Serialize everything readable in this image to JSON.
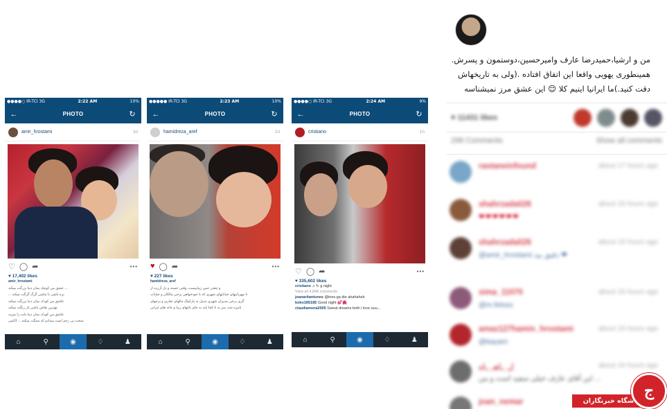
{
  "phones": [
    {
      "status": {
        "carrier": "●●●●○ IR-TCI  3G",
        "time": "2:22 AM",
        "battery": "10%"
      },
      "nav_title": "PHOTO",
      "username": "amir_hrostami",
      "ago": "3d",
      "likes": "♥ 17,402 likes",
      "caption_user": "amir_hrostami",
      "caption_lines": [
        "... عشق من کوچک بمان دنیا بزرگت میکند",
        "بره باشی با تیاشی گرگ گرگت میکند ...",
        "عاشق من کودک بمان دنیا بزرگت میکند",
        "بهترین نقاش باشی باز رنگت میکند",
        "عاشق من کودک بمان دنیا دلت را میزند",
        "سخت بی رحم است میدانم که سنگت میکند ... لاکیتی"
      ]
    },
    {
      "status": {
        "carrier": "●●●●● IR-TCI  3G",
        "time": "2:23 AM",
        "battery": "10%"
      },
      "nav_title": "PHOTO",
      "username": "hamidreza_aref",
      "ago": "2d",
      "likes": "♥ 227 likes",
      "caption_user": "hamidreza_aref",
      "caption_lines": [
        "و چقدر حس زیباییست، وقتی خسته و دل آزرده از",
        "نا مهربانیهای خیابانهای شهری که با خودخواهی برخی مالکان و خیابات",
        "گری برخی مدیران شهری تبدیل به پارکینگ مالهای تجاری و برجهای",
        "تابیزه شد، سر به تا کجا باید به جای باغهای زیبا و خانه های ایرانی"
      ]
    },
    {
      "status": {
        "carrier": "●●●●○ IR-TCI  3G",
        "time": "2:24 AM",
        "battery": "9%"
      },
      "nav_title": "PHOTO",
      "username": "cristiano",
      "ago": "1h",
      "likes": "♥ 335,602 likes",
      "comment_lines": [
        {
          "user": "cristiano",
          "text": " ♫ ↻ g night"
        },
        {
          "user": "",
          "text": "View all 4,848 comments"
        },
        {
          "user": "joanaritantunes",
          "text": " @ines.ga die ahahahah"
        },
        {
          "user": "koko185185",
          "text": " Good night 💕🌺"
        },
        {
          "user": "claudiamora2005",
          "text": " Sweat dreams both i love uuu..."
        }
      ]
    }
  ],
  "right_panel": {
    "caption": "من و ارشیا،حمیدرضا عارف وامیرحسین،دوستمون و پسرش. همینطوری یهویی واقعا این اتفاق افتاده .(ولی به تاریخهاش دقت کنید.)ما ایرانیا اینیم کلا 😌 این عشق مرز نمیشناسه",
    "likes_text": "♥ 11431 likes",
    "comments_count": "298 Comments",
    "show_all": "Show all comments",
    "comments": [
      {
        "name": "rastaneinfound",
        "time": "about 17 hours ago",
        "text": ""
      },
      {
        "name": "shahrzadali26",
        "time": "about 16 hours ago",
        "text": "❤❤❤❤❤❤"
      },
      {
        "name": "shahrzadali26",
        "time": "about 16 hours ago",
        "text": "@amir_hrostami دقیق بید ❤"
      },
      {
        "name": "sima_11070",
        "time": "about 16 hours ago",
        "text": "@m.feloss"
      },
      {
        "name": "amaz127hamin_hrostami",
        "time": "about 16 hours ago",
        "text": "@bayam"
      },
      {
        "name": "ل_ـاهـ_ـاه",
        "time": "about 16 hours ago",
        "text": "این آقای عارف خیلی سفید است و من ..."
      },
      {
        "name": "joan_nemar",
        "time": "about 16 hours ago",
        "text": ""
      }
    ]
  },
  "logo": {
    "text": "باشگاه خبرنگاران",
    "mark": "ج"
  },
  "colors": {
    "nav": "#0c4a78",
    "tabbar": "#1e2a33",
    "tab_active": "#1c6cad",
    "link": "#1c4b75",
    "accent_red": "#d2232a"
  }
}
